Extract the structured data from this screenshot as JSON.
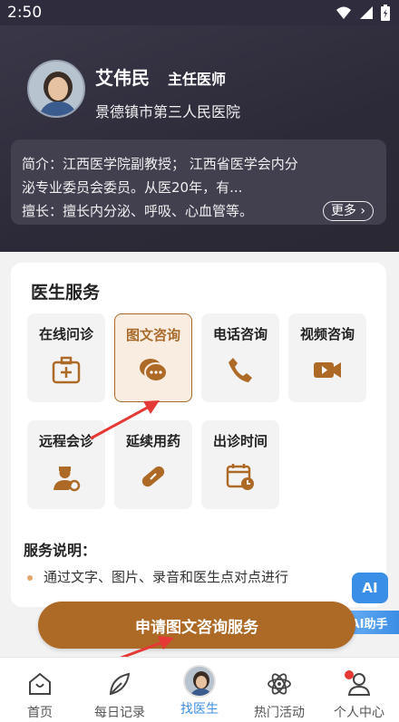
{
  "status": {
    "time": "2:50"
  },
  "doctor": {
    "name": "艾伟民",
    "title": "主任医师",
    "hospital": "景德镇市第三人民医院"
  },
  "intro": {
    "line1": "简介：江西医学院副教授； 江西省医学会内分",
    "line2": "泌专业委员会委员。从医20年，有...",
    "line3": "擅长：擅长内分泌、呼吸、心血管等。",
    "more_label": "更多"
  },
  "services": {
    "title": "医生服务",
    "items": [
      {
        "label": "在线问诊",
        "icon": "hospital-kit-icon"
      },
      {
        "label": "图文咨询",
        "icon": "chat-bubble-icon"
      },
      {
        "label": "电话咨询",
        "icon": "phone-icon"
      },
      {
        "label": "视频咨询",
        "icon": "video-icon"
      },
      {
        "label": "远程会诊",
        "icon": "doctor-icon"
      },
      {
        "label": "延续用药",
        "icon": "pill-icon"
      },
      {
        "label": "出诊时间",
        "icon": "calendar-icon"
      }
    ]
  },
  "notes": {
    "title": "服务说明：",
    "item1": "通过文字、图片、录音和医生点对点进行"
  },
  "apply_button": "申请图文咨询服务",
  "ai": {
    "badge": "AI",
    "helper": "AI助手"
  },
  "tabs": [
    {
      "label": "首页",
      "icon": "home-icon"
    },
    {
      "label": "每日记录",
      "icon": "leaf-pen-icon"
    },
    {
      "label": "找医生",
      "icon": "doctor-avatar"
    },
    {
      "label": "热门活动",
      "icon": "atom-icon"
    },
    {
      "label": "个人中心",
      "icon": "user-icon"
    }
  ],
  "colors": {
    "accent": "#ad6a27",
    "header_bg": "#2f2d3d",
    "active_tab": "#3d8fe0"
  }
}
